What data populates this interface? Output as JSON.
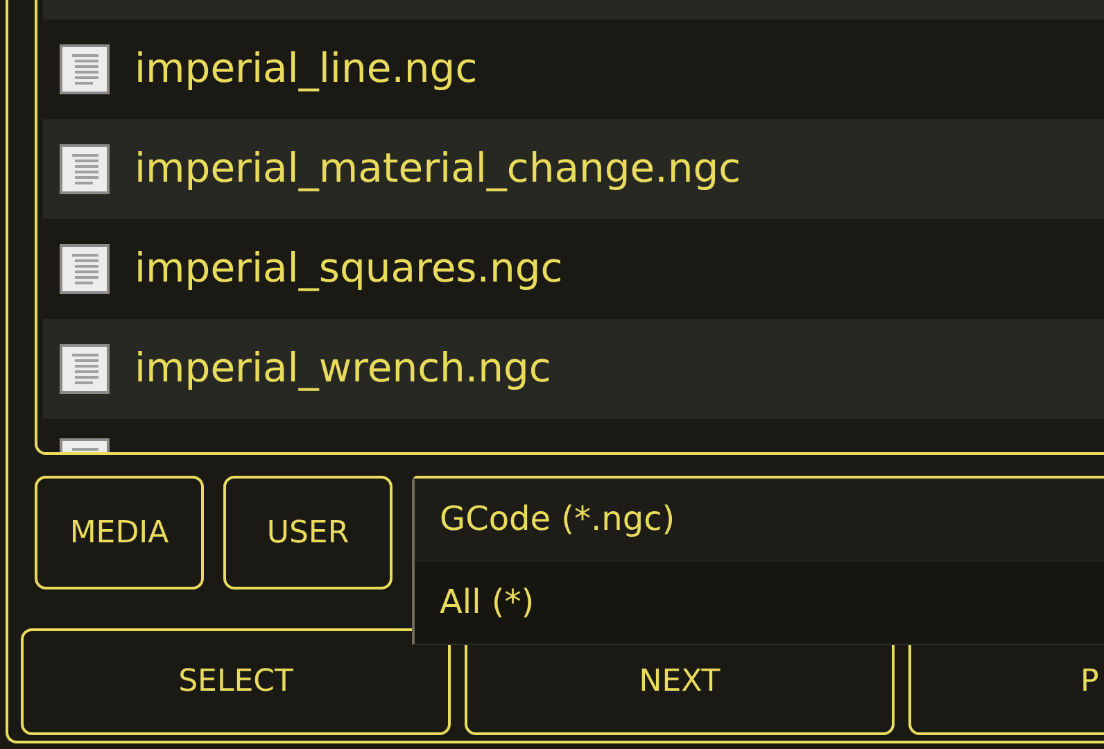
{
  "file_list": {
    "files": [
      {
        "name": "imperial_line.ngc"
      },
      {
        "name": "imperial_material_change.ngc"
      },
      {
        "name": "imperial_squares.ngc"
      },
      {
        "name": "imperial_wrench.ngc"
      }
    ]
  },
  "location_buttons": [
    "MEDIA",
    "USER"
  ],
  "filter_menu": {
    "options": [
      {
        "label": "GCode (*.ngc)",
        "selected": true
      },
      {
        "label": "All (*)",
        "selected": false
      }
    ]
  },
  "action_buttons": [
    "SELECT",
    "NEXT",
    "P"
  ]
}
